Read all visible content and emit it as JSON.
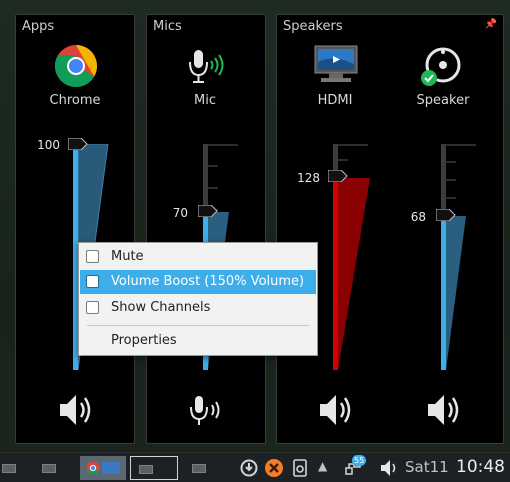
{
  "panels": {
    "apps_title": "Apps",
    "mics_title": "Mics",
    "speakers_title": "Speakers"
  },
  "channels": [
    {
      "label": "Chrome",
      "volume": "100",
      "level": 1.0,
      "icon": "chrome-icon"
    },
    {
      "label": "Mic",
      "volume": "70",
      "level": 0.7,
      "icon": "microphone-icon"
    },
    {
      "label": "HDMI",
      "volume": "128",
      "level": 1.28,
      "icon": "monitor-icon"
    },
    {
      "label": "Speaker",
      "volume": "68",
      "level": 0.68,
      "icon": "speaker-device-icon"
    }
  ],
  "context_menu": {
    "mute": "Mute",
    "volume_boost": "Volume Boost (150% Volume)",
    "show_channels": "Show Channels",
    "properties": "Properties"
  },
  "taskbar": {
    "day": "Sat11",
    "time": "10:48",
    "badge": "55"
  },
  "colors": {
    "accent": "#3daee9",
    "boost_red": "#d30000",
    "fill_blue": "#2a6f99"
  }
}
